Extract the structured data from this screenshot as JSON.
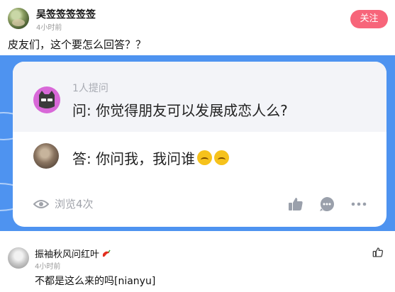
{
  "post": {
    "author": "吴签签签签签",
    "time": "4小时前",
    "follow_label": "关注",
    "text": "皮友们，这个要怎么回答？？"
  },
  "card": {
    "asker_count": "1人提问",
    "question": "问: 你觉得朋友可以发展成恋人么?",
    "answer": "答: 你问我，我问谁",
    "answer_emoji": "upside-down-face-icon",
    "views": "浏览4次",
    "actions": [
      "thumbs-up-icon",
      "comment-bubble-icon",
      "more-icon"
    ]
  },
  "comment": {
    "author": "振袖秋风问红叶",
    "author_badge_icon": "chili-pepper-icon",
    "time": "4小时前",
    "text": "不都是这么来的吗[nianyu]"
  },
  "colors": {
    "follow_button": "#f7657a",
    "card_background": "#4e93f0",
    "question_area": "#f3f4f8",
    "muted_text": "#a0a3aa"
  }
}
